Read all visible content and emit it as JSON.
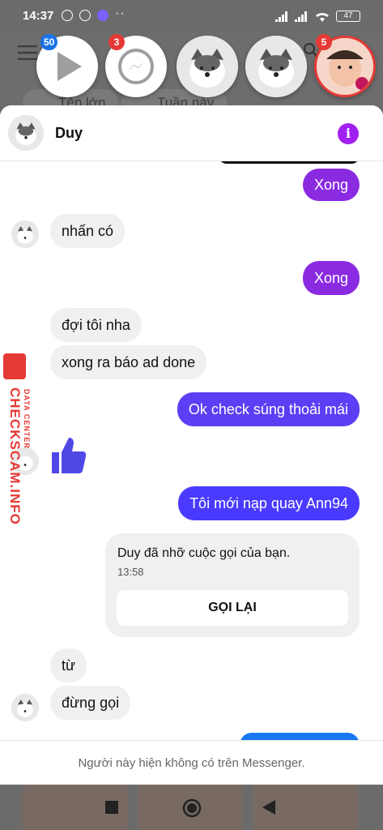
{
  "status": {
    "time": "14:37",
    "battery": "47"
  },
  "bg_app": {
    "pill1": "Tệp lớn",
    "pill2": "Tuần này"
  },
  "bubbles": [
    {
      "badge": "50",
      "icon": "play-icon"
    },
    {
      "badge": "3",
      "icon": "messenger-icon"
    },
    {
      "badge": "",
      "icon": "husky-avatar"
    },
    {
      "badge": "",
      "icon": "husky-avatar"
    },
    {
      "badge": "5",
      "icon": "child-avatar"
    }
  ],
  "chat": {
    "contact_name": "Duy",
    "messages": [
      {
        "dir": "out",
        "text": "Xong"
      },
      {
        "dir": "in",
        "text": "nhấn có"
      },
      {
        "dir": "out",
        "text": "Xong"
      },
      {
        "dir": "in",
        "text": "đợi tôi nha"
      },
      {
        "dir": "in",
        "text": "xong ra báo ad done"
      },
      {
        "dir": "out",
        "text": "Ok check súng thoải mái"
      },
      {
        "dir": "out",
        "text": "Tôi mới nạp quay Ann94"
      },
      {
        "dir": "in",
        "text": "từ"
      },
      {
        "dir": "in",
        "text": "đừng gọi"
      }
    ],
    "call_card": {
      "text": "Duy đã nhỡ cuộc gọi của bạn.",
      "time": "13:58",
      "button": "GỌI LẠI"
    },
    "footer": "Người này hiện không có trên Messenger."
  },
  "watermark": {
    "main": "CHECKSCAM.INFO",
    "sub": "DATA CENTER"
  },
  "colors": {
    "accent": "#8a2be2",
    "blue_bubble": "#4a3aff",
    "info": "#a020f0"
  }
}
